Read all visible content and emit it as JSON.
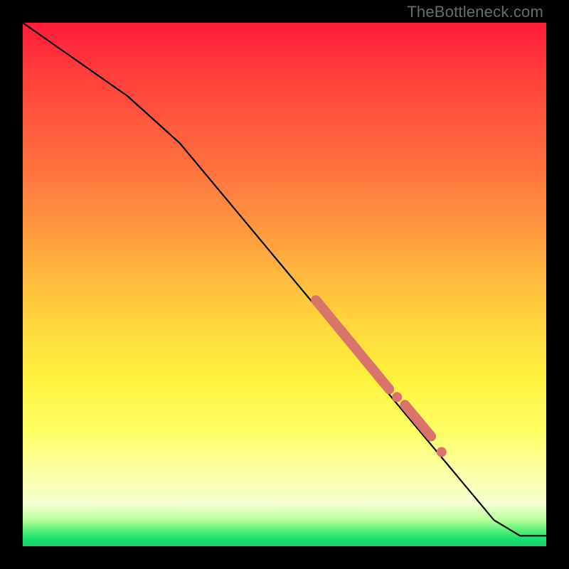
{
  "watermark": "TheBottleneck.com",
  "chart_data": {
    "type": "line",
    "title": "",
    "xlabel": "",
    "ylabel": "",
    "xlim": [
      0,
      100
    ],
    "ylim": [
      0,
      100
    ],
    "series": [
      {
        "name": "curve",
        "x": [
          0,
          10,
          20,
          30,
          40,
          50,
          60,
          70,
          80,
          90,
          95,
          100
        ],
        "values": [
          100,
          93,
          86,
          77,
          65,
          53,
          41,
          29,
          17,
          5,
          2,
          2
        ]
      }
    ],
    "highlight_segments": [
      {
        "x0": 56,
        "y0": 47,
        "x1": 70,
        "y1": 30,
        "thick": true
      },
      {
        "x0": 73,
        "y0": 27,
        "x1": 78,
        "y1": 21,
        "thick": true
      }
    ],
    "highlight_points": [
      {
        "x": 71.5,
        "y": 28.5
      },
      {
        "x": 80,
        "y": 18
      }
    ],
    "highlight_color": "#d9746b",
    "line_color": "#000000"
  }
}
